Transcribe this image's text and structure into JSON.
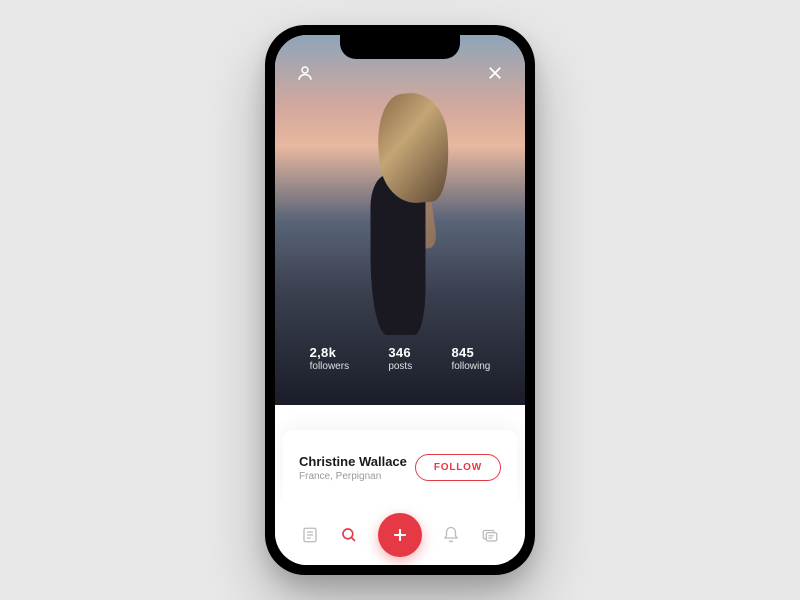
{
  "stats": {
    "followers": {
      "value": "2,8k",
      "label": "followers"
    },
    "posts": {
      "value": "346",
      "label": "posts"
    },
    "following": {
      "value": "845",
      "label": "following"
    }
  },
  "user": {
    "name": "Christine Wallace",
    "location": "France, Perpignan"
  },
  "actions": {
    "follow": "FOLLOW"
  },
  "colors": {
    "accent": "#e63946"
  }
}
